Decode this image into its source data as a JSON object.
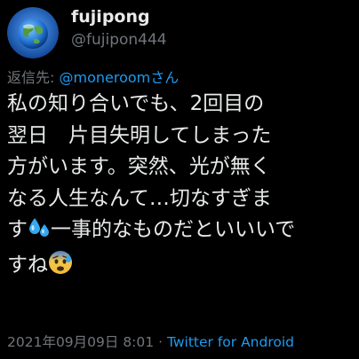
{
  "profile": {
    "display_name": "fujipong",
    "handle": "@fujipon444"
  },
  "reply": {
    "prefix": "返信先:",
    "mention": "@moneroomさん"
  },
  "tweet": {
    "lines": [
      "私の知り合いでも、2回目の",
      "翌日　片目失明してしまった",
      "方がいます。突然、光が無く",
      "なる人生なんて…切なすぎま"
    ],
    "line5_a": "す",
    "line5_b": "一事的なものだといいいで",
    "line6_a": "すね"
  },
  "footer": {
    "timestamp": "2021年09月09日 8:01",
    "separator": "·",
    "source": "Twitter for Android"
  },
  "colors": {
    "background": "#000000",
    "text": "#e7e9ea",
    "secondary": "#71767b",
    "link": "#1d9bf0"
  },
  "icons": [
    "globe-avatar",
    "sweat-droplets-emoji",
    "anxious-face-emoji"
  ]
}
